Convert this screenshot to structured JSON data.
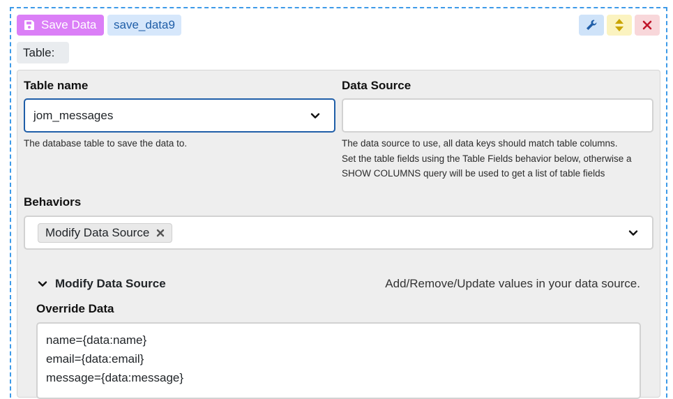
{
  "header": {
    "save_button_label": "Save Data",
    "instance_name": "save_data9",
    "table_label": "Table:"
  },
  "form": {
    "table_name": {
      "label": "Table name",
      "value": "jom_messages",
      "help": "The database table to save the data to."
    },
    "data_source": {
      "label": "Data Source",
      "value": "",
      "help_lines": [
        "The data source to use, all data keys should match table columns.",
        "Set the table fields using the Table Fields behavior below, otherwise a",
        "SHOW COLUMNS query will be used to get a list of table fields"
      ]
    },
    "behaviors": {
      "label": "Behaviors",
      "selected": [
        "Modify Data Source"
      ]
    },
    "modify_section": {
      "title": "Modify Data Source",
      "description": "Add/Remove/Update values in your data source.",
      "override_label": "Override Data",
      "override_lines": [
        "name={data:name}",
        "email={data:email}",
        "message={data:message}"
      ]
    }
  },
  "colors": {
    "save_button": "#db7ff7",
    "tag_bg": "#d6e7fb",
    "focus_border": "#1f5ea8",
    "frame_border": "#3d9ae8"
  },
  "icons": [
    "floppy-disk-icon",
    "wrench-icon",
    "sort-arrows-icon",
    "close-icon",
    "chevron-down-icon",
    "remove-x-icon"
  ]
}
